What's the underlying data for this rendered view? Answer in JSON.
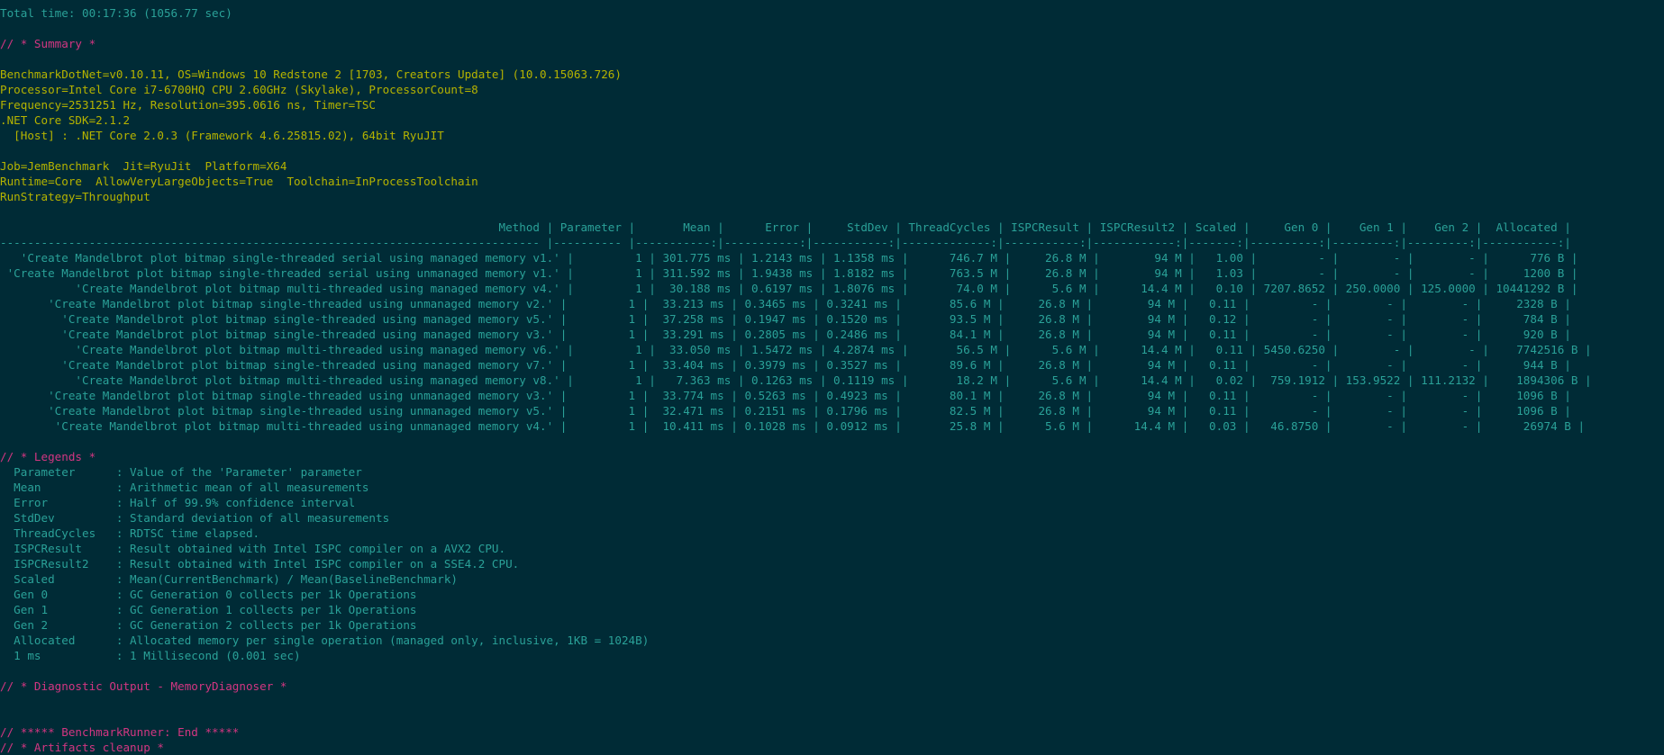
{
  "total_time": "Total time: 00:17:36 (1056.77 sec)",
  "summary_header": "// * Summary *",
  "env": [
    "BenchmarkDotNet=v0.10.11, OS=Windows 10 Redstone 2 [1703, Creators Update] (10.0.15063.726)",
    "Processor=Intel Core i7-6700HQ CPU 2.60GHz (Skylake), ProcessorCount=8",
    "Frequency=2531251 Hz, Resolution=395.0616 ns, Timer=TSC",
    ".NET Core SDK=2.1.2",
    "  [Host] : .NET Core 2.0.3 (Framework 4.6.25815.02), 64bit RyuJIT"
  ],
  "job": [
    "Job=JemBenchmark  Jit=RyuJit  Platform=X64",
    "Runtime=Core  AllowVeryLargeObjects=True  Toolchain=InProcessToolchain",
    "RunStrategy=Throughput"
  ],
  "table": {
    "header": "                                                                         Method | Parameter |       Mean |      Error |     StdDev | ThreadCycles | ISPCResult | ISPCResult2 | Scaled |     Gen 0 |    Gen 1 |    Gen 2 |  Allocated |",
    "divider": "------------------------------------------------------------------------------- |---------- |-----------:|-----------:|-----------:|-------------:|-----------:|------------:|-------:|----------:|---------:|---------:|-----------:|",
    "rows": [
      "   'Create Mandelbrot plot bitmap single-threaded serial using managed memory v1.' |         1 | 301.775 ms | 1.2143 ms | 1.1358 ms |      746.7 M |     26.8 M |        94 M |   1.00 |         - |        - |        - |      776 B |",
      " 'Create Mandelbrot plot bitmap single-threaded serial using unmanaged memory v1.' |         1 | 311.592 ms | 1.9438 ms | 1.8182 ms |      763.5 M |     26.8 M |        94 M |   1.03 |         - |        - |        - |     1200 B |",
      "           'Create Mandelbrot plot bitmap multi-threaded using managed memory v4.' |         1 |  30.188 ms | 0.6197 ms | 1.8076 ms |       74.0 M |      5.6 M |      14.4 M |   0.10 | 7207.8652 | 250.0000 | 125.0000 | 10441292 B |",
      "       'Create Mandelbrot plot bitmap single-threaded using unmanaged memory v2.' |         1 |  33.213 ms | 0.3465 ms | 0.3241 ms |       85.6 M |     26.8 M |        94 M |   0.11 |         - |        - |        - |     2328 B |",
      "         'Create Mandelbrot plot bitmap single-threaded using managed memory v5.' |         1 |  37.258 ms | 0.1947 ms | 0.1520 ms |       93.5 M |     26.8 M |        94 M |   0.12 |         - |        - |        - |      784 B |",
      "         'Create Mandelbrot plot bitmap single-threaded using managed memory v3.' |         1 |  33.291 ms | 0.2805 ms | 0.2486 ms |       84.1 M |     26.8 M |        94 M |   0.11 |         - |        - |        - |      920 B |",
      "           'Create Mandelbrot plot bitmap multi-threaded using managed memory v6.' |         1 |  33.050 ms | 1.5472 ms | 4.2874 ms |       56.5 M |      5.6 M |      14.4 M |   0.11 | 5450.6250 |        - |        - |    7742516 B |",
      "         'Create Mandelbrot plot bitmap single-threaded using managed memory v7.' |         1 |  33.404 ms | 0.3979 ms | 0.3527 ms |       89.6 M |     26.8 M |        94 M |   0.11 |         - |        - |        - |      944 B |",
      "           'Create Mandelbrot plot bitmap multi-threaded using managed memory v8.' |         1 |   7.363 ms | 0.1263 ms | 0.1119 ms |       18.2 M |      5.6 M |      14.4 M |   0.02 |  759.1912 | 153.9522 | 111.2132 |    1894306 B |",
      "       'Create Mandelbrot plot bitmap single-threaded using unmanaged memory v3.' |         1 |  33.774 ms | 0.5263 ms | 0.4923 ms |       80.1 M |     26.8 M |        94 M |   0.11 |         - |        - |        - |     1096 B |",
      "       'Create Mandelbrot plot bitmap single-threaded using unmanaged memory v5.' |         1 |  32.471 ms | 0.2151 ms | 0.1796 ms |       82.5 M |     26.8 M |        94 M |   0.11 |         - |        - |        - |     1096 B |",
      "        'Create Mandelbrot plot bitmap multi-threaded using unmanaged memory v4.' |         1 |  10.411 ms | 0.1028 ms | 0.0912 ms |       25.8 M |      5.6 M |      14.4 M |   0.03 |   46.8750 |        - |        - |      26974 B |"
    ]
  },
  "legends_header": "// * Legends *",
  "legends": [
    {
      "key": "Parameter",
      "desc": ": Value of the 'Parameter' parameter"
    },
    {
      "key": "Mean",
      "desc": ": Arithmetic mean of all measurements"
    },
    {
      "key": "Error",
      "desc": ": Half of 99.9% confidence interval"
    },
    {
      "key": "StdDev",
      "desc": ": Standard deviation of all measurements"
    },
    {
      "key": "ThreadCycles",
      "desc": ": RDTSC time elapsed."
    },
    {
      "key": "ISPCResult",
      "desc": ": Result obtained with Intel ISPC compiler on a AVX2 CPU."
    },
    {
      "key": "ISPCResult2",
      "desc": ": Result obtained with Intel ISPC compiler on a SSE4.2 CPU."
    },
    {
      "key": "Scaled",
      "desc": ": Mean(CurrentBenchmark) / Mean(BaselineBenchmark)"
    },
    {
      "key": "Gen 0",
      "desc": ": GC Generation 0 collects per 1k Operations"
    },
    {
      "key": "Gen 1",
      "desc": ": GC Generation 1 collects per 1k Operations"
    },
    {
      "key": "Gen 2",
      "desc": ": GC Generation 2 collects per 1k Operations"
    },
    {
      "key": "Allocated",
      "desc": ": Allocated memory per single operation (managed only, inclusive, 1KB = 1024B)"
    },
    {
      "key": "1 ms",
      "desc": ": 1 Millisecond (0.001 sec)"
    }
  ],
  "diag_header": "// * Diagnostic Output - MemoryDiagnoser *",
  "runner_end": "// ***** BenchmarkRunner: End *****",
  "artifacts": "// * Artifacts cleanup *",
  "colors": {
    "background": "#002b36",
    "text_cyan": "#2aa198",
    "text_yellow": "#b5b300",
    "text_magenta": "#d33682"
  }
}
